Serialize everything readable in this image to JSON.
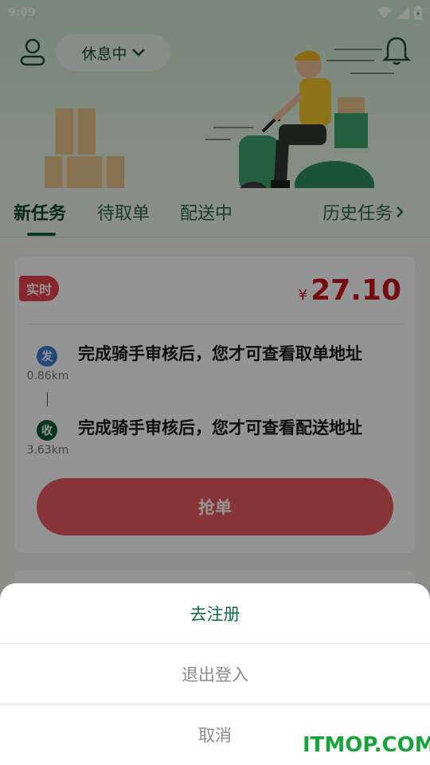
{
  "status_bar": {
    "time": "9:09",
    "wifi_icon": "wifi-icon",
    "signal_icon": "cell-signal-icon",
    "battery_icon": "battery-charging-icon"
  },
  "header": {
    "user_icon": "user-profile-icon",
    "work_status": "休息中",
    "bell_icon": "bell-icon"
  },
  "tabs": [
    {
      "label": "新任务",
      "active": true
    },
    {
      "label": "待取单",
      "active": false
    },
    {
      "label": "配送中",
      "active": false
    },
    {
      "label": "历史任务",
      "active": false
    }
  ],
  "order_card": {
    "tag": "实时",
    "price_symbol": "¥",
    "price": "27.10",
    "pickup": {
      "badge": "发",
      "distance": "0.86km",
      "address": "完成骑手审核后，您才可查看取单地址"
    },
    "delivery": {
      "badge": "收",
      "distance": "3.63km",
      "address": "完成骑手审核后，您才可查看配送地址"
    },
    "grab_button": "抢单"
  },
  "action_sheet": {
    "items": [
      {
        "label": "去注册",
        "style": "primary"
      },
      {
        "label": "退出登入",
        "style": "secondary"
      },
      {
        "label": "取消",
        "style": "secondary"
      }
    ]
  },
  "watermark": "ITMOP.COM",
  "colors": {
    "brand_green": "#0f6b40",
    "price_red": "#c8161d",
    "grab_button": "#e85a5e",
    "pickup_badge": "#3d7fd6",
    "delivery_badge": "#0d5c34"
  }
}
